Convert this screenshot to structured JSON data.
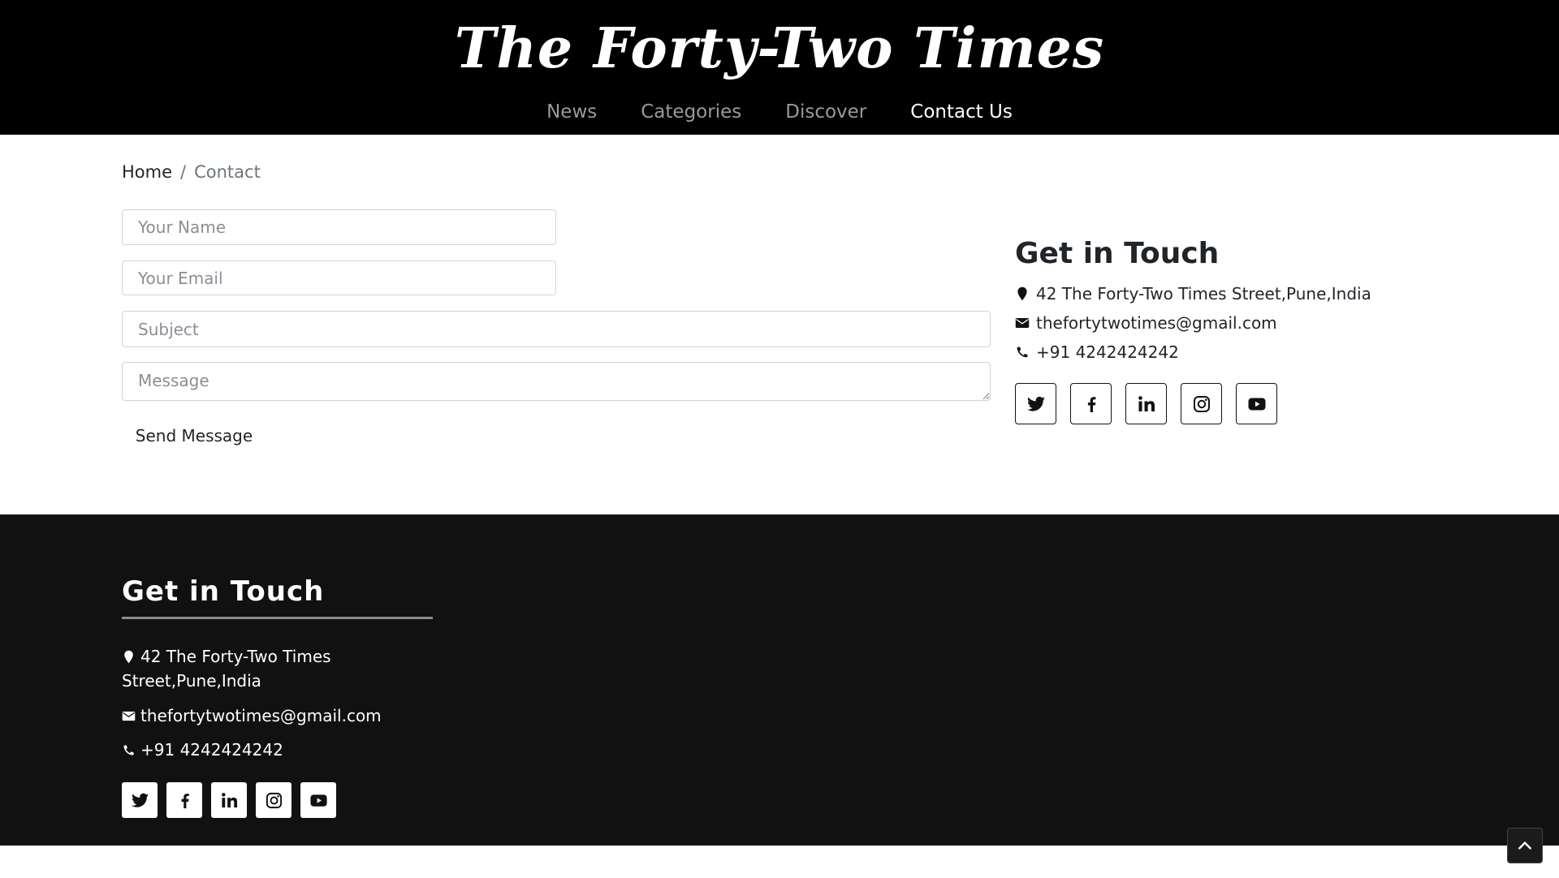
{
  "header": {
    "masthead": "The Forty-Two Times",
    "nav": [
      {
        "label": "News",
        "active": false
      },
      {
        "label": "Categories",
        "active": false
      },
      {
        "label": "Discover",
        "active": false
      },
      {
        "label": "Contact Us",
        "active": true
      }
    ]
  },
  "breadcrumb": {
    "home": "Home",
    "separator": "/",
    "current": "Contact"
  },
  "form": {
    "name_placeholder": "Your Name",
    "email_placeholder": "Your Email",
    "subject_placeholder": "Subject",
    "message_placeholder": "Message",
    "submit_label": "Send Message"
  },
  "contact": {
    "title": "Get in Touch",
    "address": "42 The Forty-Two Times Street,Pune,India",
    "email": "thefortytwotimes@gmail.com",
    "phone": "+91 4242424242",
    "social_icons": [
      "twitter-icon",
      "facebook-icon",
      "linkedin-icon",
      "instagram-icon",
      "youtube-icon"
    ]
  },
  "footer": {
    "title": "Get in Touch",
    "address": "42 The Forty-Two Times Street,Pune,India",
    "email": "thefortytwotimes@gmail.com",
    "phone": "+91 4242424242",
    "social_icons": [
      "twitter-icon",
      "facebook-icon",
      "linkedin-icon",
      "instagram-icon",
      "youtube-icon"
    ]
  },
  "colors": {
    "header_bg": "#000000",
    "footer_bg": "#111111",
    "nav_active": "#ffffff",
    "nav_inactive": "#9a9a9a"
  }
}
